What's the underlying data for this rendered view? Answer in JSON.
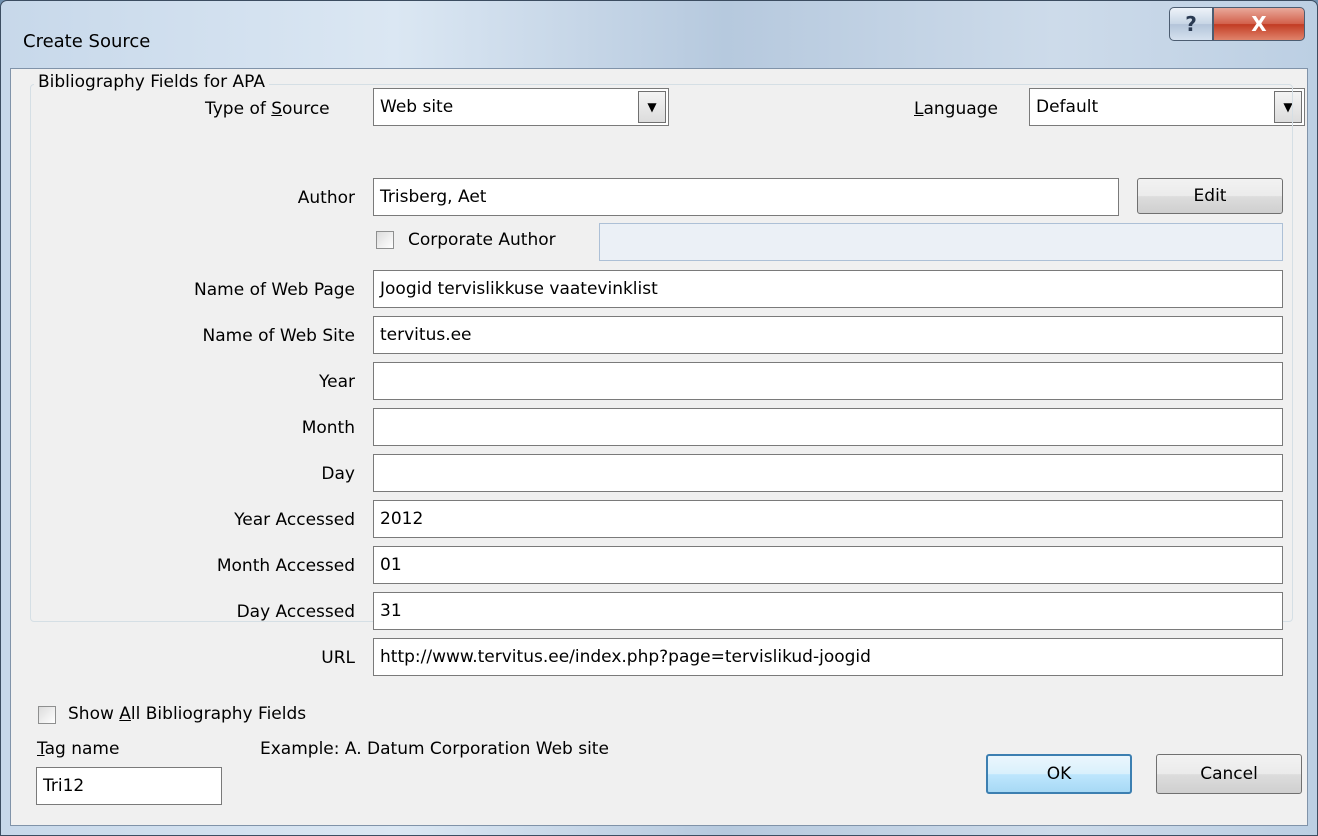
{
  "window": {
    "title": "Create Source",
    "help_glyph": "?",
    "close_glyph": "X"
  },
  "type_of_source": {
    "label_pre": "Type of ",
    "label_key": "S",
    "label_post": "ource",
    "value": "Web site"
  },
  "language": {
    "label_key": "L",
    "label_post": "anguage",
    "value": "Default"
  },
  "group_title": "Bibliography Fields for APA",
  "author": {
    "label": "Author",
    "value": "Trisberg, Aet",
    "edit_label": "Edit",
    "corporate_label": "Corporate Author",
    "corporate_value": ""
  },
  "fields": [
    {
      "label": "Name of Web Page",
      "value": "Joogid tervislikkuse vaatevinklist"
    },
    {
      "label": "Name of Web Site",
      "value": "tervitus.ee"
    },
    {
      "label": "Year",
      "value": ""
    },
    {
      "label": "Month",
      "value": ""
    },
    {
      "label": "Day",
      "value": ""
    },
    {
      "label": "Year Accessed",
      "value": "2012"
    },
    {
      "label": "Month Accessed",
      "value": "01"
    },
    {
      "label": "Day Accessed",
      "value": "31"
    },
    {
      "label": "URL",
      "value": "http://www.tervitus.ee/index.php?page=tervislikud-joogid"
    }
  ],
  "show_all": {
    "label_pre": "Show ",
    "label_key": "A",
    "label_post": "ll Bibliography Fields"
  },
  "tag": {
    "label_key": "T",
    "label_post": "ag name",
    "value": "Tri12",
    "example": "Example: A. Datum Corporation Web site"
  },
  "buttons": {
    "ok": "OK",
    "cancel": "Cancel"
  },
  "icons": {
    "dropdown": "▼"
  }
}
